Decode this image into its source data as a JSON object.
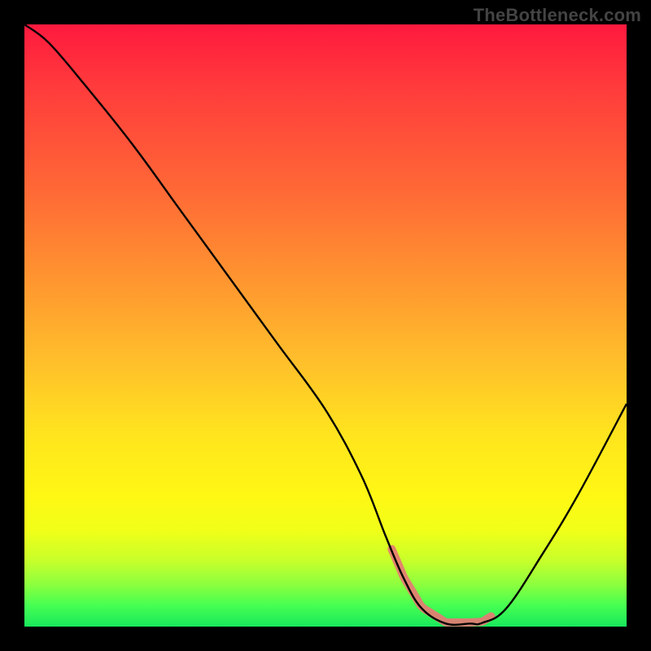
{
  "watermark": "TheBottleneck.com",
  "chart_data": {
    "type": "line",
    "title": "",
    "xlabel": "",
    "ylabel": "",
    "xlim": [
      0,
      100
    ],
    "ylim": [
      0,
      100
    ],
    "grid": false,
    "series": [
      {
        "name": "curve",
        "x": [
          0,
          4,
          10,
          18,
          26,
          34,
          42,
          50,
          56,
          60,
          63,
          66,
          70,
          74,
          76,
          80,
          86,
          92,
          100
        ],
        "y": [
          100,
          97,
          90,
          80,
          69,
          58,
          47,
          36,
          25,
          15,
          8,
          3,
          0.5,
          0.5,
          0.6,
          3,
          12,
          22,
          37
        ],
        "note": "V-shaped black curve; flat valley between x≈63 and x≈76"
      }
    ],
    "valley_highlight": {
      "x_start": 61,
      "x_end": 77.5,
      "color": "#e77a74",
      "note": "light red rounded segment tracing the curve at the valley floor"
    },
    "background": {
      "type": "vertical_gradient",
      "stops": [
        {
          "pos": 0.0,
          "color": "#ff193e"
        },
        {
          "pos": 0.28,
          "color": "#ff6a36"
        },
        {
          "pos": 0.56,
          "color": "#ffbf2b"
        },
        {
          "pos": 0.8,
          "color": "#fff714"
        },
        {
          "pos": 0.93,
          "color": "#8cff3e"
        },
        {
          "pos": 1.0,
          "color": "#18e85c"
        }
      ]
    }
  }
}
